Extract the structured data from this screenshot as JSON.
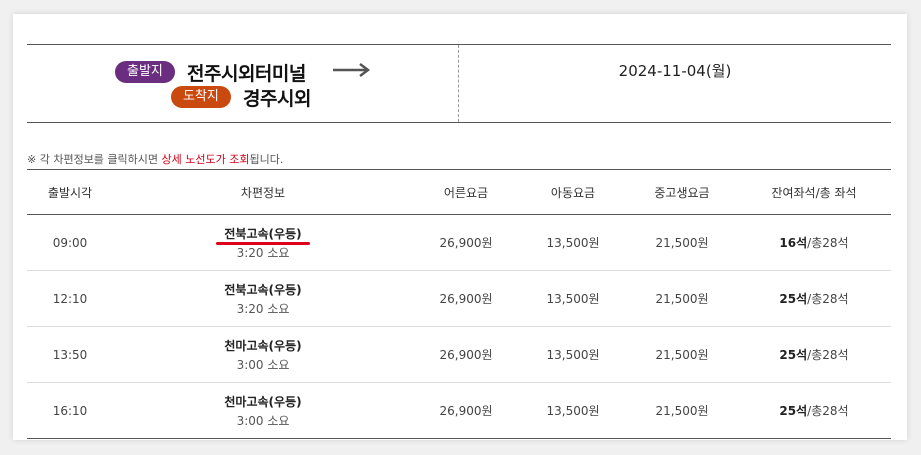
{
  "route": {
    "departure_badge": "출발지",
    "departure_city": "전주시외터미널",
    "arrival_badge": "도착지",
    "arrival_city": "경주시외",
    "date": "2024-11-04(월)"
  },
  "notice": {
    "prefix": "※ 각 차편정보를 클릭하시면 ",
    "highlight": "상세 노선도가 조회",
    "suffix": "됩니다."
  },
  "table": {
    "headers": [
      "출발시각",
      "차편정보",
      "어른요금",
      "아동요금",
      "중고생요금",
      "잔여좌석/총 좌석"
    ],
    "rows": [
      {
        "time": "09:00",
        "bus": "전북고속(우등)",
        "duration": "3:20 소요",
        "adult": "26,900원",
        "child": "13,500원",
        "student": "21,500원",
        "seats_left": "16석",
        "seats_total": "/총28석"
      },
      {
        "time": "12:10",
        "bus": "전북고속(우등)",
        "duration": "3:20 소요",
        "adult": "26,900원",
        "child": "13,500원",
        "student": "21,500원",
        "seats_left": "25석",
        "seats_total": "/총28석"
      },
      {
        "time": "13:50",
        "bus": "천마고속(우등)",
        "duration": "3:00 소요",
        "adult": "26,900원",
        "child": "13,500원",
        "student": "21,500원",
        "seats_left": "25석",
        "seats_total": "/총28석"
      },
      {
        "time": "16:10",
        "bus": "천마고속(우등)",
        "duration": "3:00 소요",
        "adult": "26,900원",
        "child": "13,500원",
        "student": "21,500원",
        "seats_left": "25석",
        "seats_total": "/총28석"
      }
    ]
  },
  "colors": {
    "departure_badge": "#6b2d7f",
    "arrival_badge": "#c9490f",
    "highlight": "#d0021b"
  }
}
